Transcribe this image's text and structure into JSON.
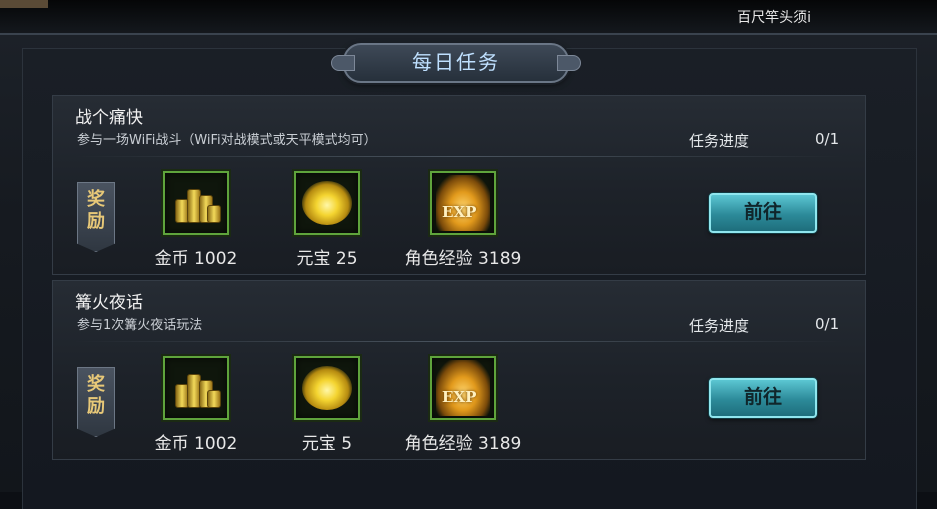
{
  "header": {
    "player_name": "百尺竿头须i"
  },
  "title": "每日任务",
  "reward_tag": "奖励",
  "progress_label": "任务进度",
  "tasks": [
    {
      "name": "战个痛快",
      "desc": "参与一场WiFi战斗（WiFi对战模式或天平模式均可）",
      "progress": "0/1",
      "rewards": [
        {
          "icon": "gold-coins-icon",
          "label": "金币 1002"
        },
        {
          "icon": "yuanbao-ingot-icon",
          "label": "元宝 25"
        },
        {
          "icon": "exp-icon",
          "label": "角色经验 3189",
          "icon_text": "EXP"
        }
      ],
      "button": "前往"
    },
    {
      "name": "篝火夜话",
      "desc": "参与1次篝火夜话玩法",
      "progress": "0/1",
      "rewards": [
        {
          "icon": "gold-coins-icon",
          "label": "金币 1002"
        },
        {
          "icon": "yuanbao-ingot-icon",
          "label": "元宝 5"
        },
        {
          "icon": "exp-icon",
          "label": "角色经验 3189",
          "icon_text": "EXP"
        }
      ],
      "button": "前往"
    }
  ],
  "colors": {
    "accent_button": "#2c8a99",
    "title_text": "#bfe0ff",
    "reward_tag_text": "#e7c878",
    "item_border": "#5fa43c"
  }
}
